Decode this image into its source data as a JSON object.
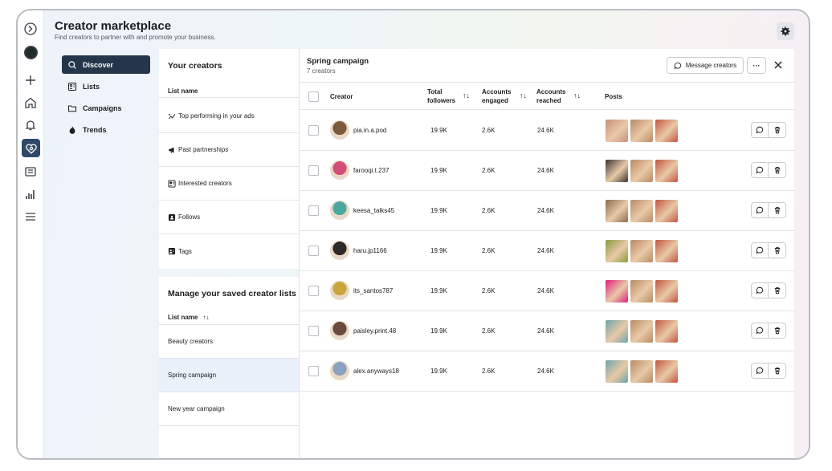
{
  "header": {
    "title": "Creator marketplace",
    "subtitle": "Find creators to partner with and promote your business."
  },
  "rail_icons": [
    "logo-icon",
    "profile-avatar",
    "plus-icon",
    "home-icon",
    "bell-icon",
    "creator-marketplace-icon",
    "media-icon",
    "insights-icon",
    "menu-icon"
  ],
  "nav": {
    "items": [
      {
        "label": "Discover",
        "icon": "search-icon",
        "active": true
      },
      {
        "label": "Lists",
        "icon": "lists-icon",
        "active": false
      },
      {
        "label": "Campaigns",
        "icon": "folder-icon",
        "active": false
      },
      {
        "label": "Trends",
        "icon": "flame-icon",
        "active": false
      }
    ]
  },
  "your_creators": {
    "title": "Your creators",
    "column": "List name",
    "lists": [
      {
        "label": "Top performing in your ads",
        "icon": "sparkle-chart-icon"
      },
      {
        "label": "Past partnerships",
        "icon": "megaphone-icon"
      },
      {
        "label": "Interested creators",
        "icon": "person-list-icon"
      },
      {
        "label": "Follows",
        "icon": "follow-icon"
      },
      {
        "label": "Tags",
        "icon": "tag-icon"
      }
    ]
  },
  "saved_lists": {
    "title": "Manage your saved creator lists",
    "column": "List name",
    "sort": "↑↓",
    "lists": [
      {
        "label": "Beauty creators",
        "selected": false
      },
      {
        "label": "Spring campaign",
        "selected": true
      },
      {
        "label": "New year campaign",
        "selected": false
      }
    ]
  },
  "campaign": {
    "title": "Spring campaign",
    "subtitle": "7 creators",
    "message_button": "Message creators",
    "more_button": "···"
  },
  "table": {
    "headers": {
      "creator": "Creator",
      "followers_1": "Total",
      "followers_2": "followers",
      "engaged_1": "Accounts",
      "engaged_2": "engaged",
      "reached_1": "Accounts",
      "reached_2": "reached",
      "posts": "Posts",
      "sort": "↑↓"
    },
    "rows": [
      {
        "name": "pia.in.a.pod",
        "followers": "19.9K",
        "engaged": "2.6K",
        "reached": "24.6K",
        "avatar_color": "#7a5a3a",
        "posts": [
          "#c98f7e",
          "#b88b63",
          "#c4553f"
        ]
      },
      {
        "name": "farooqi.t.237",
        "followers": "19.9K",
        "engaged": "2.6K",
        "reached": "24.6K",
        "avatar_color": "#d24d78",
        "posts": [
          "#3b3530",
          "#b88b63",
          "#c4553f"
        ]
      },
      {
        "name": "keesa_talks45",
        "followers": "19.9K",
        "engaged": "2.6K",
        "reached": "24.6K",
        "avatar_color": "#4aa8a0",
        "posts": [
          "#8a6a4c",
          "#b88b63",
          "#c4553f"
        ]
      },
      {
        "name": "haru.jp1166",
        "followers": "19.9K",
        "engaged": "2.6K",
        "reached": "24.6K",
        "avatar_color": "#2e2a28",
        "posts": [
          "#8c9a3a",
          "#b88b63",
          "#c4553f"
        ]
      },
      {
        "name": "its_santos787",
        "followers": "19.9K",
        "engaged": "2.6K",
        "reached": "24.6K",
        "avatar_color": "#c8a63a",
        "posts": [
          "#e0207a",
          "#b88b63",
          "#c4553f"
        ]
      },
      {
        "name": "paisley.print.48",
        "followers": "19.9K",
        "engaged": "2.6K",
        "reached": "24.6K",
        "avatar_color": "#6a4a3c",
        "posts": [
          "#6fa4a8",
          "#b88b63",
          "#c4553f"
        ]
      },
      {
        "name": "alex.anyways18",
        "followers": "19.9K",
        "engaged": "2.6K",
        "reached": "24.6K",
        "avatar_color": "#8aa0c0",
        "posts": [
          "#6fa4a8",
          "#b88b63",
          "#c4553f"
        ]
      }
    ]
  },
  "colors": {
    "nav_active": "#24364a",
    "rail_active": "#2f4a66",
    "selected_row": "#e9f1fb"
  }
}
